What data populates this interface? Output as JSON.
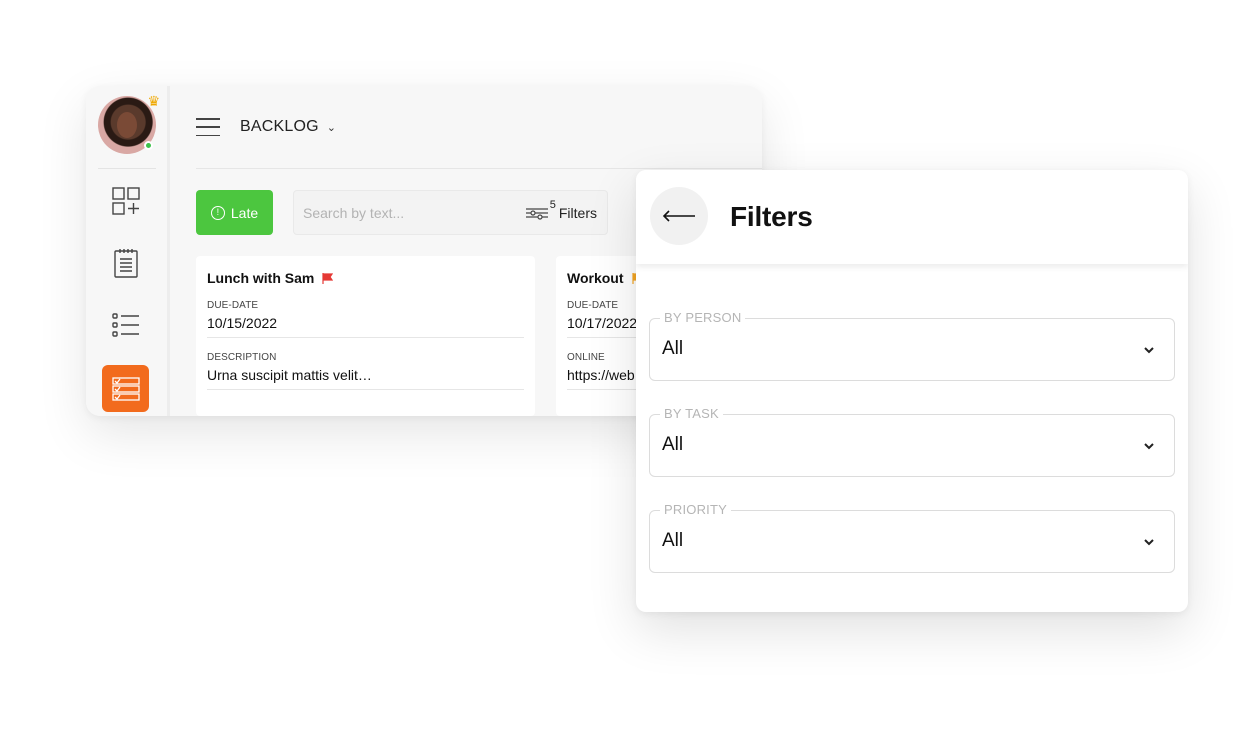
{
  "app": {
    "view_title": "BACKLOG",
    "late_button": "Late",
    "search": {
      "placeholder": "Search by text..."
    },
    "filters_button": {
      "label": "Filters",
      "count": "5"
    },
    "cards": [
      {
        "title": "Lunch with Sam",
        "flag_color": "#e53935",
        "fields": [
          {
            "label": "DUE-DATE",
            "value": "10/15/2022"
          },
          {
            "label": "DESCRIPTION",
            "value": "Urna suscipit mattis velit…"
          }
        ]
      },
      {
        "title": "Workout",
        "flag_color": "#f5a623",
        "fields": [
          {
            "label": "DUE-DATE",
            "value": "10/17/2022"
          },
          {
            "label": "ONLINE",
            "value": "https://web"
          }
        ]
      }
    ],
    "rail_icons": [
      "dashboard-add-icon",
      "notepad-icon",
      "list-icon",
      "board-icon"
    ]
  },
  "filters_panel": {
    "title": "Filters",
    "back_icon": "arrow-left-icon",
    "fields": [
      {
        "label": "BY PERSON",
        "value": "All"
      },
      {
        "label": "BY TASK",
        "value": "All"
      },
      {
        "label": "PRIORITY",
        "value": "All"
      }
    ]
  },
  "colors": {
    "late": "#4cc63f",
    "active_rail": "#f26b1d",
    "online_dot": "#3cc24a",
    "crown": "#f0a800"
  }
}
